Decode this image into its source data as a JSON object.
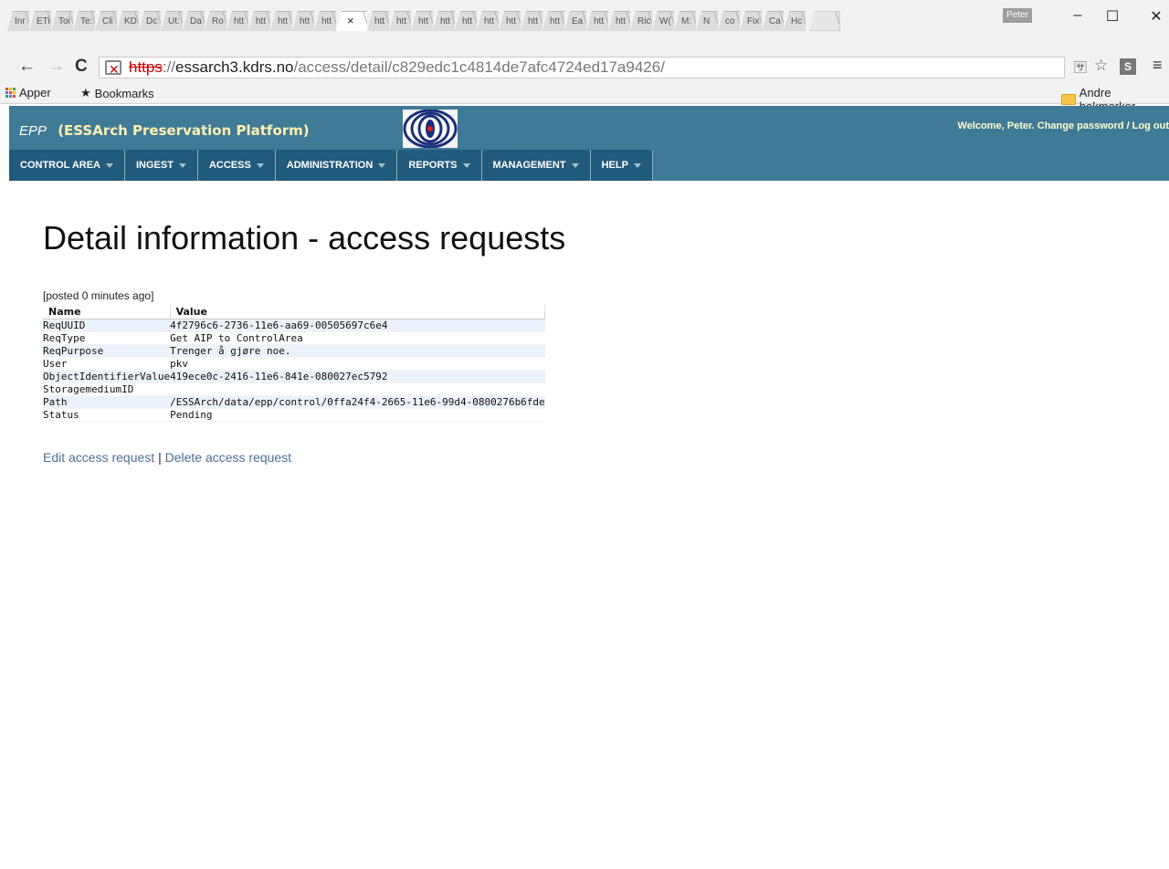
{
  "browser": {
    "tabs": [
      "Inr",
      "ETi",
      "Toi",
      "Te:",
      "Cli",
      "KD",
      "Dc",
      "Ut:",
      "Da",
      "Ro",
      "htt",
      "htt",
      "htt",
      "htt",
      "htt",
      "htt",
      "htt",
      "htt",
      "htt",
      "htt",
      "htt",
      "htt",
      "htt",
      "htt",
      "Ea",
      "htt",
      "htt",
      "Ric",
      "W(",
      "M:",
      "N",
      "co",
      "Fix",
      "Ca",
      "Hc"
    ],
    "active_tab_index": 15,
    "active_tab_glyph": "×",
    "profile_name": "Peter",
    "window_buttons": {
      "minimize": "–",
      "maximize": "☐",
      "close": "✕"
    },
    "nav": {
      "back": "←",
      "forward": "→",
      "reload": "C",
      "menu": "≡"
    },
    "url": {
      "scheme": "https",
      "rest": "://",
      "host": "essarch3.kdrs.no",
      "path": "/access/detail/c829edc1c4814de7afc4724ed17a9426/"
    },
    "bookmarks": {
      "apps_label": "Apper",
      "bookmarks_label": "Bookmarks",
      "other_label": "Andre bokmerker"
    },
    "colors": {
      "insecure": "#cc0000"
    }
  },
  "app": {
    "abbr": "EPP",
    "title": "(ESSArch Preservation Platform)",
    "welcome": "Welcome, Peter. Change password / Log out",
    "colors": {
      "header_bg": "#3f7a96",
      "menu_bg": "#225b7b",
      "title_accent": "#fff0b0",
      "link": "#4a6f99"
    },
    "menu": [
      "CONTROL AREA",
      "INGEST",
      "ACCESS",
      "ADMINISTRATION",
      "REPORTS",
      "MANAGEMENT",
      "HELP"
    ]
  },
  "page": {
    "title": "Detail information - access requests",
    "posted": "[posted 0 minutes ago]",
    "table": {
      "headers": [
        "Name",
        "Value"
      ],
      "rows": [
        [
          "ReqUUID",
          "4f2796c6-2736-11e6-aa69-00505697c6e4"
        ],
        [
          "ReqType",
          "Get AIP to ControlArea"
        ],
        [
          "ReqPurpose",
          "Trenger å gjøre noe."
        ],
        [
          "User",
          "pkv"
        ],
        [
          "ObjectIdentifierValue",
          "419ece0c-2416-11e6-841e-080027ec5792"
        ],
        [
          "StoragemediumID",
          ""
        ],
        [
          "Path",
          "/ESSArch/data/epp/control/0ffa24f4-2665-11e6-99d4-0800276b6fde"
        ],
        [
          "Status",
          "Pending"
        ]
      ]
    },
    "actions": {
      "edit": "Edit access request",
      "separator": "|",
      "delete": "Delete access request"
    }
  }
}
